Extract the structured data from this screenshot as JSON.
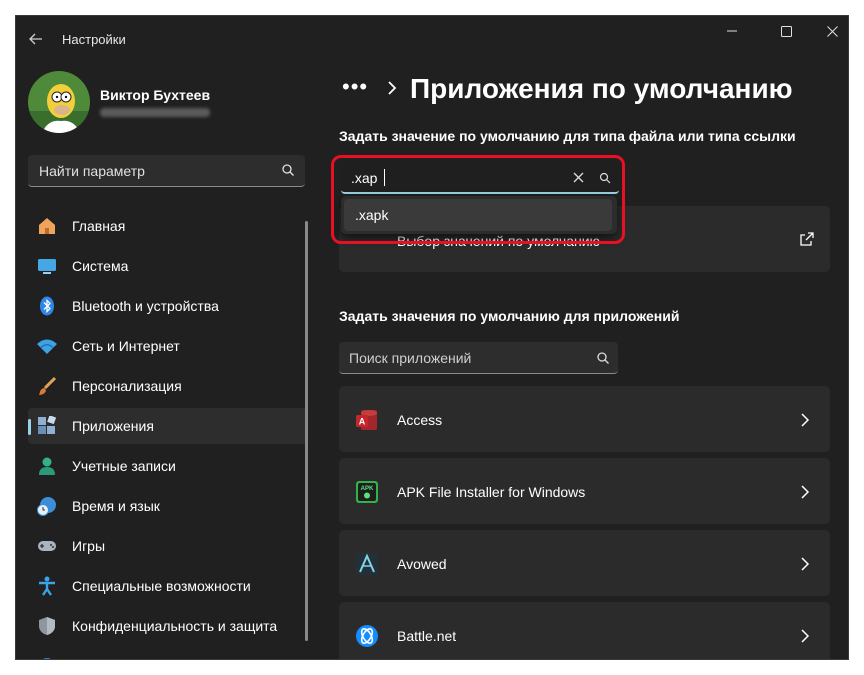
{
  "window": {
    "title": "Настройки"
  },
  "user": {
    "name": "Виктор Бухтеев"
  },
  "search": {
    "placeholder": "Найти параметр"
  },
  "nav": {
    "items": [
      {
        "label": "Главная",
        "icon": "home-icon"
      },
      {
        "label": "Система",
        "icon": "monitor-icon"
      },
      {
        "label": "Bluetooth и устройства",
        "icon": "bluetooth-icon"
      },
      {
        "label": "Сеть и Интернет",
        "icon": "wifi-icon"
      },
      {
        "label": "Персонализация",
        "icon": "brush-icon"
      },
      {
        "label": "Приложения",
        "icon": "apps-icon",
        "active": true
      },
      {
        "label": "Учетные записи",
        "icon": "person-icon"
      },
      {
        "label": "Время и язык",
        "icon": "clock-globe-icon"
      },
      {
        "label": "Игры",
        "icon": "gamepad-icon"
      },
      {
        "label": "Специальные возможности",
        "icon": "accessibility-icon"
      },
      {
        "label": "Конфиденциальность и защита",
        "icon": "shield-icon"
      }
    ]
  },
  "main": {
    "breadcrumb_more": "•••",
    "page_title": "Приложения по умолчанию",
    "filetype_section_title": "Задать значение по умолчанию для типа файла или типа ссылки",
    "filetype_input_value": ".xap",
    "filetype_suggestion": ".xapk",
    "filetype_card_label": "Выбор значений по умолчанию",
    "apps_section_title": "Задать значения по умолчанию для приложений",
    "apps_search_placeholder": "Поиск приложений",
    "apps": [
      {
        "name": "Access",
        "icon": "access-icon"
      },
      {
        "name": "APK File Installer for Windows",
        "icon": "apk-installer-icon"
      },
      {
        "name": "Avowed",
        "icon": "avowed-icon"
      },
      {
        "name": "Battle.net",
        "icon": "battlenet-icon"
      }
    ]
  },
  "colors": {
    "accent": "#9bd3e6",
    "highlight": "#e81123",
    "background": "#202020",
    "card": "#2b2b2b"
  }
}
